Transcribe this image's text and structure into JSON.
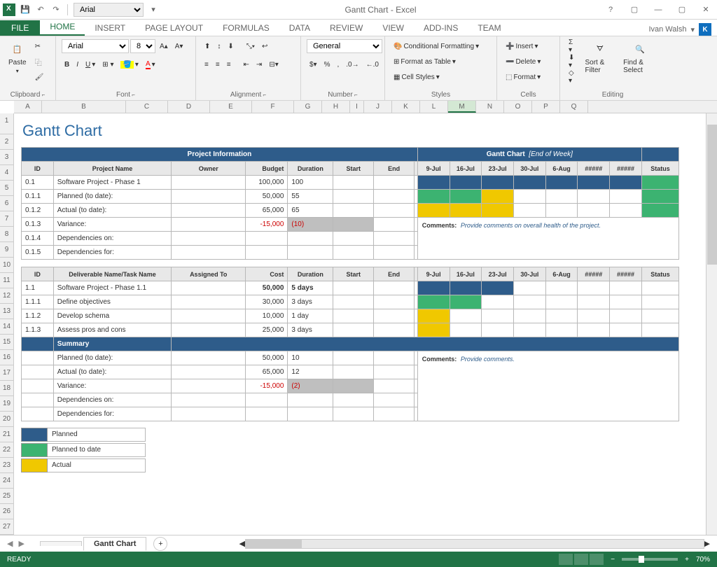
{
  "title": "Gantt Chart - Excel",
  "user": "Ivan Walsh",
  "qat_font": "Arial",
  "tabs": [
    "HOME",
    "INSERT",
    "PAGE LAYOUT",
    "FORMULAS",
    "DATA",
    "REVIEW",
    "VIEW",
    "ADD-INS",
    "TEAM"
  ],
  "tab_file": "FILE",
  "ribbon": {
    "clipboard": {
      "label": "Clipboard",
      "paste": "Paste"
    },
    "font": {
      "label": "Font",
      "name": "Arial",
      "size": "8"
    },
    "alignment": {
      "label": "Alignment"
    },
    "number": {
      "label": "Number",
      "format": "General"
    },
    "styles": {
      "label": "Styles",
      "cond": "Conditional Formatting",
      "table": "Format as Table",
      "cell": "Cell Styles"
    },
    "cells": {
      "label": "Cells",
      "insert": "Insert",
      "delete": "Delete",
      "format": "Format"
    },
    "editing": {
      "label": "Editing",
      "sort": "Sort & Filter",
      "find": "Find & Select"
    }
  },
  "cols": [
    "A",
    "B",
    "C",
    "D",
    "E",
    "F",
    "G",
    "H",
    "I",
    "J",
    "K",
    "L",
    "M",
    "N",
    "O",
    "P",
    "Q"
  ],
  "rows": [
    "1",
    "2",
    "3",
    "4",
    "5",
    "6",
    "7",
    "8",
    "9",
    "10",
    "11",
    "12",
    "13",
    "14",
    "15",
    "16",
    "17",
    "18",
    "19",
    "20",
    "21",
    "22",
    "23",
    "24",
    "25",
    "26",
    "27"
  ],
  "chart_title": "Gantt Chart",
  "section1": "Project Information",
  "section2": "Gantt Chart",
  "section2_sub": "[End of Week]",
  "hdr": {
    "id": "ID",
    "pname": "Project Name",
    "owner": "Owner",
    "budget": "Budget",
    "duration": "Duration",
    "start": "Start",
    "end": "End",
    "status": "Status",
    "deliv": "Deliverable Name/Task Name",
    "assigned": "Assigned To",
    "cost": "Cost"
  },
  "dates": [
    "9-Jul",
    "16-Jul",
    "23-Jul",
    "30-Jul",
    "6-Aug",
    "#####",
    "#####"
  ],
  "proj": [
    {
      "id": "0.1",
      "name": "Software Project - Phase 1",
      "budget": "100,000",
      "dur": "100",
      "g": [
        "b",
        "b",
        "b",
        "b",
        "b",
        "b",
        "b"
      ],
      "st": "g"
    },
    {
      "id": "0.1.1",
      "name": "Planned (to date):",
      "budget": "50,000",
      "dur": "55",
      "g": [
        "g",
        "g",
        "y",
        "",
        "",
        "",
        ""
      ],
      "st": "g"
    },
    {
      "id": "0.1.2",
      "name": "Actual (to date):",
      "budget": "65,000",
      "dur": "65",
      "g": [
        "y",
        "y",
        "y",
        "",
        "",
        "",
        ""
      ],
      "st": "g"
    },
    {
      "id": "0.1.3",
      "name": "Variance:",
      "budget": "-15,000",
      "dur": "(10)",
      "neg": true,
      "grey": true
    },
    {
      "id": "0.1.4",
      "name": "Dependencies on:"
    },
    {
      "id": "0.1.5",
      "name": "Dependencies for:"
    }
  ],
  "comments1_lbl": "Comments:",
  "comments1": "Provide comments on overall health of the project.",
  "tasks": [
    {
      "id": "1.1",
      "name": "Software Project - Phase 1.1",
      "cost": "50,000",
      "dur": "5 days",
      "bold": true,
      "g": [
        "b",
        "b",
        "b",
        "",
        "",
        "",
        ""
      ]
    },
    {
      "id": "1.1.1",
      "name": "Define objectives",
      "cost": "30,000",
      "dur": "3 days",
      "g": [
        "g",
        "g",
        "",
        "",
        "",
        "",
        ""
      ]
    },
    {
      "id": "1.1.2",
      "name": "Develop schema",
      "cost": "10,000",
      "dur": "1 day",
      "g": [
        "y",
        "",
        "",
        "",
        "",
        "",
        ""
      ]
    },
    {
      "id": "1.1.3",
      "name": "Assess pros and cons",
      "cost": "25,000",
      "dur": "3 days",
      "g": [
        "y",
        "",
        "",
        "",
        "",
        "",
        ""
      ]
    }
  ],
  "summary_lbl": "Summary",
  "summary": [
    {
      "name": "Planned (to date):",
      "cost": "50,000",
      "dur": "10"
    },
    {
      "name": "Actual (to date):",
      "cost": "65,000",
      "dur": "12"
    },
    {
      "name": "Variance:",
      "cost": "-15,000",
      "dur": "(2)",
      "neg": true,
      "grey": true
    },
    {
      "name": "Dependencies on:"
    },
    {
      "name": "Dependencies for:"
    }
  ],
  "comments2_lbl": "Comments:",
  "comments2": "Provide comments.",
  "legend": [
    {
      "color": "b",
      "label": "Planned"
    },
    {
      "color": "g",
      "label": "Planned to date"
    },
    {
      "color": "y",
      "label": "Actual"
    }
  ],
  "sheet_tabs": [
    "",
    "Gantt Chart"
  ],
  "status_ready": "READY",
  "zoom": "70%"
}
